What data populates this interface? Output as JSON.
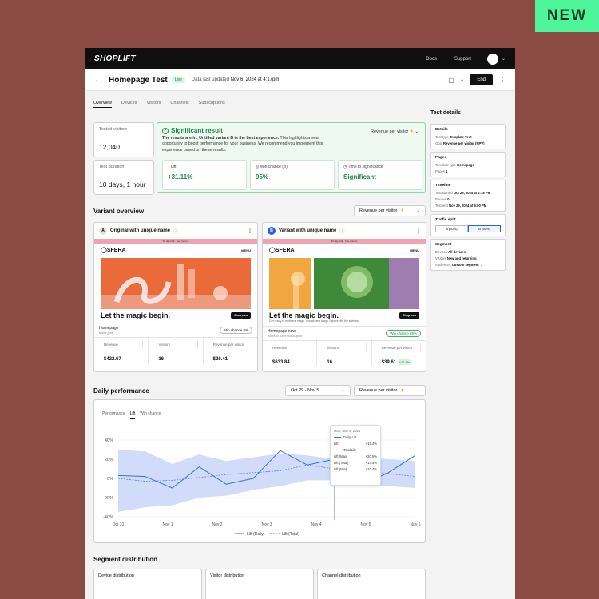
{
  "badge": "NEW",
  "topnav": {
    "logo": "SHOPLIFT",
    "docs": "Docs",
    "support": "Support"
  },
  "header": {
    "title": "Homepage Test",
    "status": "Live",
    "updated_label": "Data last updated",
    "updated_value": "Nov 6, 2024 at 4:17pm",
    "end": "End"
  },
  "tabs": [
    "Overview",
    "Devices",
    "Visitors",
    "Channels",
    "Subscriptions"
  ],
  "summary": {
    "tested_visitors_label": "Tested visitors",
    "tested_visitors": "12,040",
    "duration_label": "Test duration",
    "duration": "10 days, 1 hour"
  },
  "result": {
    "title": "Significant result",
    "lead": "The results are in: Untitled variant B is the best experience.",
    "body": " This highlights a new opportunity to boost performance for your business. We recommend you implement this experience based on these results.",
    "goal": "Revenue per visitor",
    "metrics": [
      {
        "label": "Lift",
        "value": "+31.11%"
      },
      {
        "label": "Win chance (B)",
        "value": "95%"
      },
      {
        "label": "Time to significance",
        "value": "Significant"
      }
    ]
  },
  "variant_overview": {
    "title": "Variant overview",
    "goal": "Revenue per visitor",
    "variants": [
      {
        "letter": "A",
        "name": "Original with unique name",
        "promo": "30 day trial · free returns",
        "brand": "SFERA",
        "menu": "MENU",
        "headline": "Let the magic begin.",
        "sub": "",
        "cta": "Shop now",
        "page": "Homepage",
        "url": "index.json",
        "win": "Win chance 5%",
        "revenue": "$422.67",
        "visitors": "16",
        "rpv": "$26.41",
        "rpv_delta": ""
      },
      {
        "letter": "B",
        "name": "Variant with unique name",
        "promo": "30 day trial · free returns",
        "brand": "SFERA",
        "menu": "MENU",
        "headline": "Let the magic begin.",
        "sub": "Get ready to embrace magic. Our all-new Magic Sphere hits the shelves.",
        "cta": "Shop now",
        "page": "Homepage new",
        "url": "index.cr.135F5BCA.json",
        "win": "Win chance 95%",
        "revenue": "$633.84",
        "visitors": "16",
        "rpv": "$39.61",
        "rpv_delta": "+22.5%"
      }
    ],
    "stat_labels": {
      "revenue": "Revenue",
      "visitors": "Visitors",
      "rpv": "Revenue per visitor"
    }
  },
  "daily": {
    "title": "Daily performance",
    "range": "Oct 29 - Nov 5",
    "goal": "Revenue per visitor",
    "tabs": [
      "Performance",
      "Lift",
      "Win chance"
    ],
    "tooltip": {
      "date": "Mon, Nov 4, 2024",
      "daily_lift_label": "Daily Lift",
      "lift": "Lift",
      "lift_value": "+15.4%",
      "total_lift_label": "Total Lift",
      "rows": [
        {
          "k": "Lift (Max)",
          "v": "+20.5%"
        },
        {
          "k": "Lift (Total)",
          "v": "+14.5%"
        },
        {
          "k": "Lift (Min)",
          "v": "+10.4%"
        }
      ]
    }
  },
  "chart_data": {
    "type": "line",
    "x": [
      "Oct 31",
      "Nov 1",
      "Nov 2",
      "Nov 3",
      "Nov 4",
      "Nov 5",
      "Nov 6"
    ],
    "yticks": [
      "40%",
      "20%",
      "0%",
      "-20%",
      "-40%"
    ],
    "ylim": [
      -40,
      40
    ],
    "series": [
      {
        "name": "Lift (Daily)",
        "values": [
          3,
          2,
          -10,
          12,
          -6,
          0,
          29,
          14,
          20,
          -7,
          6,
          24
        ]
      },
      {
        "name": "Lift (Total)",
        "values": [
          0,
          -3,
          -2,
          1,
          4,
          6,
          8,
          14,
          10,
          8,
          5,
          2
        ]
      }
    ],
    "band_upper": [
      30,
      28,
      15,
      25,
      18,
      22,
      26,
      24,
      20,
      22,
      20,
      18
    ],
    "band_lower": [
      -35,
      -30,
      -28,
      -20,
      -18,
      -12,
      -8,
      -2,
      -2,
      -5,
      -8,
      -10
    ],
    "legend": "bottom-center"
  },
  "segment": {
    "title": "Segment distribution",
    "cards": [
      "Device distribution",
      "Visitor distribution",
      "Channel distribution"
    ]
  },
  "details": {
    "title": "Test details",
    "sections": [
      {
        "h": "Details",
        "rows": [
          [
            "Test type",
            "Template Test"
          ],
          [
            "Goal",
            "Revenue per visitor (RPV)"
          ]
        ]
      },
      {
        "h": "Pages",
        "rows": [
          [
            "Template type",
            "Homepage"
          ],
          [
            "Pages",
            "1"
          ]
        ]
      },
      {
        "h": "Timeline",
        "rows": [
          [
            "Test started",
            "Oct 29, 2024 at 2:18 PM"
          ],
          [
            "Pauses",
            "0"
          ],
          [
            "Test end",
            "Nov 29, 2024 at 6:00 PM"
          ]
        ]
      },
      {
        "h": "Traffic split",
        "split": [
          "A (50%)",
          "B (50%)"
        ]
      },
      {
        "h": "Segment",
        "rows": [
          [
            "Devices",
            "All devices"
          ],
          [
            "Visitors",
            "New and returning"
          ],
          [
            "Audiences",
            "Custom segment"
          ]
        ]
      }
    ]
  }
}
